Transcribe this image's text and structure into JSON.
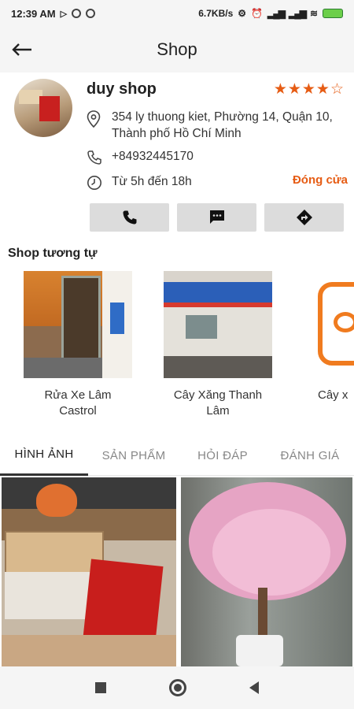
{
  "status_bar": {
    "time": "12:39 AM",
    "network_speed": "6.7KB/s"
  },
  "app_bar": {
    "back_icon": "arrow-left-icon",
    "title": "Shop"
  },
  "shop": {
    "name": "duy shop",
    "rating_stars": "★★★★☆",
    "rating": 4,
    "rating_max": 5,
    "address_line1": "354 ly thuong kiet, Phường 14, Quận 10,",
    "address_line2": "Thành phố Hồ Chí Minh",
    "phone": "+84932445170",
    "hours": "Từ 5h đến 18h",
    "status": "Đóng cửa"
  },
  "actions": [
    {
      "icon": "phone-icon"
    },
    {
      "icon": "message-icon"
    },
    {
      "icon": "directions-icon"
    }
  ],
  "similar": {
    "title": "Shop tương tự",
    "items": [
      {
        "label_line1": "Rửa Xe Lâm",
        "label_line2": "Castrol"
      },
      {
        "label_line1": "Cây Xăng Thanh",
        "label_line2": "Lâm"
      },
      {
        "label_line1": "Cây x",
        "label_line2": ""
      }
    ]
  },
  "tabs": [
    {
      "label": "HÌNH ẢNH",
      "active": true
    },
    {
      "label": "SẢN PHẨM",
      "active": false
    },
    {
      "label": "HỎI ĐÁP",
      "active": false
    },
    {
      "label": "ĐÁNH GIÁ",
      "active": false
    }
  ],
  "colors": {
    "accent": "#e65c14",
    "bar_bg": "#f5f5f5",
    "button_bg": "#dcdcdc"
  }
}
